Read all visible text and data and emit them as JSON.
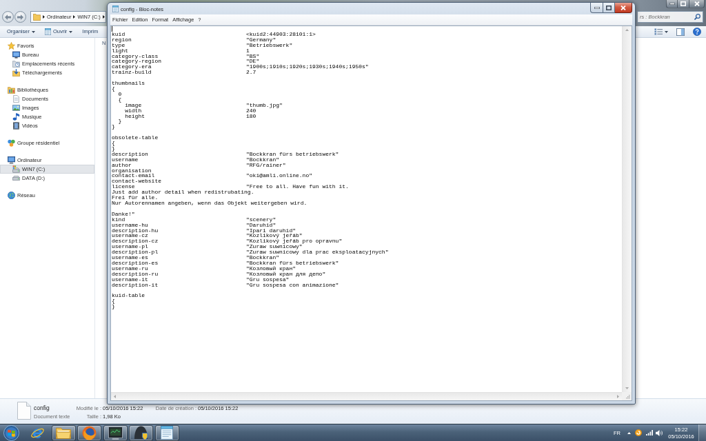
{
  "explorer": {
    "address_path": [
      "Ordinateur",
      "WIN7 (C:)"
    ],
    "search": {
      "placeholder": "rs : Bockkran"
    },
    "toolbar": [
      {
        "label": "Organiser",
        "dropdown": true
      },
      {
        "label": "Ouvrir",
        "dropdown": true
      },
      {
        "label": "Imprim",
        "dropdown": false
      }
    ],
    "sidebar": [
      {
        "label": "Favoris",
        "selected": false,
        "children": [
          {
            "label": "Bureau",
            "selected": false
          },
          {
            "label": "Emplacements récents",
            "selected": false
          },
          {
            "label": "Téléchargements",
            "selected": false
          }
        ]
      },
      {
        "label": "Bibliothèques",
        "selected": false,
        "children": [
          {
            "label": "Documents",
            "selected": false
          },
          {
            "label": "Images",
            "selected": false
          },
          {
            "label": "Musique",
            "selected": false
          },
          {
            "label": "Vidéos",
            "selected": false
          }
        ]
      },
      {
        "label": "Groupe résidentiel",
        "selected": false
      },
      {
        "label": "Ordinateur",
        "selected": false,
        "children": [
          {
            "label": "WIN7 (C:)",
            "selected": true
          },
          {
            "label": "DATA (D:)",
            "selected": false
          }
        ]
      },
      {
        "label": "Réseau",
        "selected": false
      }
    ],
    "columns": [
      "N"
    ],
    "details": {
      "name": "config",
      "type": "Document texte",
      "fields": [
        {
          "label": "Modifié le :",
          "value": "05/10/2016 15:22"
        },
        {
          "label": "Date de création :",
          "value": "05/10/2016 15:22"
        },
        {
          "label": "Taille :",
          "value": "1,98 Ko"
        }
      ]
    }
  },
  "notepad": {
    "title": "config - Bloc-notes",
    "menu": [
      "Fichier",
      "Edition",
      "Format",
      "Affichage",
      "?"
    ],
    "lines": [
      {
        "kind": "caret"
      },
      {
        "kind": "pair",
        "key": "kuid",
        "value": "<kuid2:44903:28101:1>"
      },
      {
        "kind": "pair",
        "key": "region",
        "value": "\"Germany\""
      },
      {
        "kind": "pair",
        "key": "type",
        "value": "\"Betriebswerk\""
      },
      {
        "kind": "pair",
        "key": "light",
        "value": "1"
      },
      {
        "kind": "pair",
        "key": "category-class",
        "value": "\"BS\""
      },
      {
        "kind": "pair",
        "key": "category-region",
        "value": "\"DE\""
      },
      {
        "kind": "pair",
        "key": "category-era",
        "value": "\"1900s;1910s;1920s;1930s;1940s;1950s\""
      },
      {
        "kind": "pair",
        "key": "trainz-build",
        "value": "2.7"
      },
      {
        "kind": "blank"
      },
      {
        "kind": "text",
        "text": "thumbnails"
      },
      {
        "kind": "text",
        "text": "{"
      },
      {
        "kind": "text",
        "text": "  0"
      },
      {
        "kind": "text",
        "text": "  {"
      },
      {
        "kind": "pair",
        "key": "    image",
        "value": "\"thumb.jpg\""
      },
      {
        "kind": "pair",
        "key": "    width",
        "value": "240"
      },
      {
        "kind": "pair",
        "key": "    height",
        "value": "180"
      },
      {
        "kind": "text",
        "text": "  }"
      },
      {
        "kind": "text",
        "text": "}"
      },
      {
        "kind": "blank"
      },
      {
        "kind": "text",
        "text": "obsolete-table"
      },
      {
        "kind": "text",
        "text": "{"
      },
      {
        "kind": "text",
        "text": "}"
      },
      {
        "kind": "pair",
        "key": "description",
        "value": "\"Bockkran fürs betriebswerk\""
      },
      {
        "kind": "pair",
        "key": "username",
        "value": "\"Bockkran\""
      },
      {
        "kind": "pair",
        "key": "author",
        "value": "\"RFG/rainer\""
      },
      {
        "kind": "text",
        "text": "organisation"
      },
      {
        "kind": "pair",
        "key": "contact-email",
        "value": "\"oki@amli.online.no\""
      },
      {
        "kind": "text",
        "text": "contact-website"
      },
      {
        "kind": "pair",
        "key": "license",
        "value": "\"Free to all. Have fun with it."
      },
      {
        "kind": "text",
        "text": "Just add author detail when redistrubating."
      },
      {
        "kind": "text",
        "text": "Frei für alle."
      },
      {
        "kind": "text",
        "text": "Nur Autorennamen angeben, wenn das Objekt weitergeben wird."
      },
      {
        "kind": "blank"
      },
      {
        "kind": "text",
        "text": "Danke!\""
      },
      {
        "kind": "pair",
        "key": "kind",
        "value": "\"scenery\""
      },
      {
        "kind": "pair",
        "key": "username-hu",
        "value": "\"Daruhid\""
      },
      {
        "kind": "pair",
        "key": "description-hu",
        "value": "\"Ipari daruhid\""
      },
      {
        "kind": "pair",
        "key": "username-cz",
        "value": "\"Kozlikový jeřáb\""
      },
      {
        "kind": "pair",
        "key": "description-cz",
        "value": "\"Kozlikový jeřáb pro opravnu\""
      },
      {
        "kind": "pair",
        "key": "username-pl",
        "value": "\"Zuraw suwnicowy\""
      },
      {
        "kind": "pair",
        "key": "description-pl",
        "value": "\"Zuraw suwnicowy dla prac eksploatacyjnych\""
      },
      {
        "kind": "pair",
        "key": "username-es",
        "value": "\"Bockkran\""
      },
      {
        "kind": "pair",
        "key": "description-es",
        "value": "\"Bockkran fürs betriebswerk\""
      },
      {
        "kind": "pair",
        "key": "username-ru",
        "value": "\"Козловый кран\""
      },
      {
        "kind": "pair",
        "key": "description-ru",
        "value": "\"Козловый кран для депо\""
      },
      {
        "kind": "pair",
        "key": "username-it",
        "value": "\"Gru sospesa\""
      },
      {
        "kind": "pair",
        "key": "description-it",
        "value": "\"Gru sospesa con animazione\""
      },
      {
        "kind": "blank"
      },
      {
        "kind": "text",
        "text": "kuid-table"
      },
      {
        "kind": "text",
        "text": "{"
      },
      {
        "kind": "text",
        "text": "}"
      }
    ]
  },
  "taskbar": {
    "apps": [
      {
        "running": false
      },
      {
        "running": true
      },
      {
        "running": true
      },
      {
        "running": true
      },
      {
        "running": true
      },
      {
        "running": true
      }
    ],
    "language": "FR",
    "time": "15:22",
    "date": "05/10/2016"
  }
}
